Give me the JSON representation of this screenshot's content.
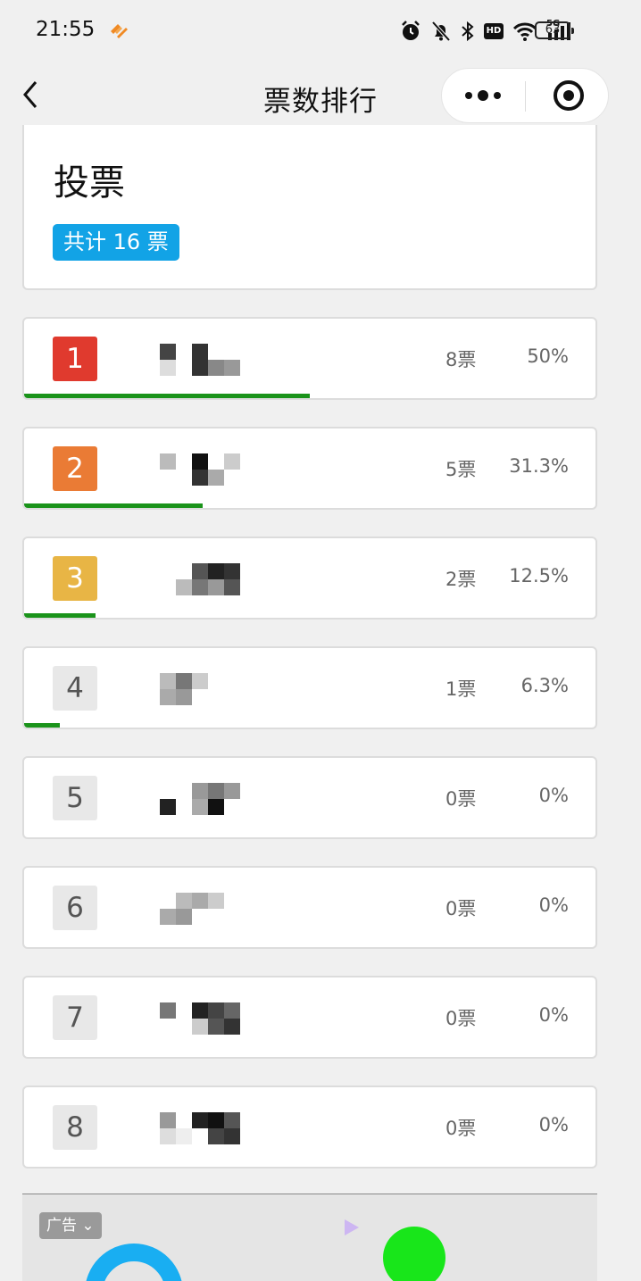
{
  "status": {
    "time": "21:55",
    "battery": "63",
    "network": "5G",
    "hd": "HD"
  },
  "nav": {
    "title": "票数排行"
  },
  "header": {
    "title": "投票",
    "total": "共计 16 票"
  },
  "ranking": [
    {
      "rank": "1",
      "votes": "8票",
      "percent": "50%",
      "share": 0.5,
      "badge_color": "#e03a2e"
    },
    {
      "rank": "2",
      "votes": "5票",
      "percent": "31.3%",
      "share": 0.313,
      "badge_color": "#ea7b35"
    },
    {
      "rank": "3",
      "votes": "2票",
      "percent": "12.5%",
      "share": 0.125,
      "badge_color": "#e8b545"
    },
    {
      "rank": "4",
      "votes": "1票",
      "percent": "6.3%",
      "share": 0.063,
      "badge_color": ""
    },
    {
      "rank": "5",
      "votes": "0票",
      "percent": "0%",
      "share": 0,
      "badge_color": ""
    },
    {
      "rank": "6",
      "votes": "0票",
      "percent": "0%",
      "share": 0,
      "badge_color": ""
    },
    {
      "rank": "7",
      "votes": "0票",
      "percent": "0%",
      "share": 0,
      "badge_color": ""
    },
    {
      "rank": "8",
      "votes": "0票",
      "percent": "0%",
      "share": 0,
      "badge_color": ""
    }
  ],
  "ad": {
    "label": "广告"
  },
  "colors": {
    "progress": "#1a931a",
    "badge": "#12a3e6"
  }
}
